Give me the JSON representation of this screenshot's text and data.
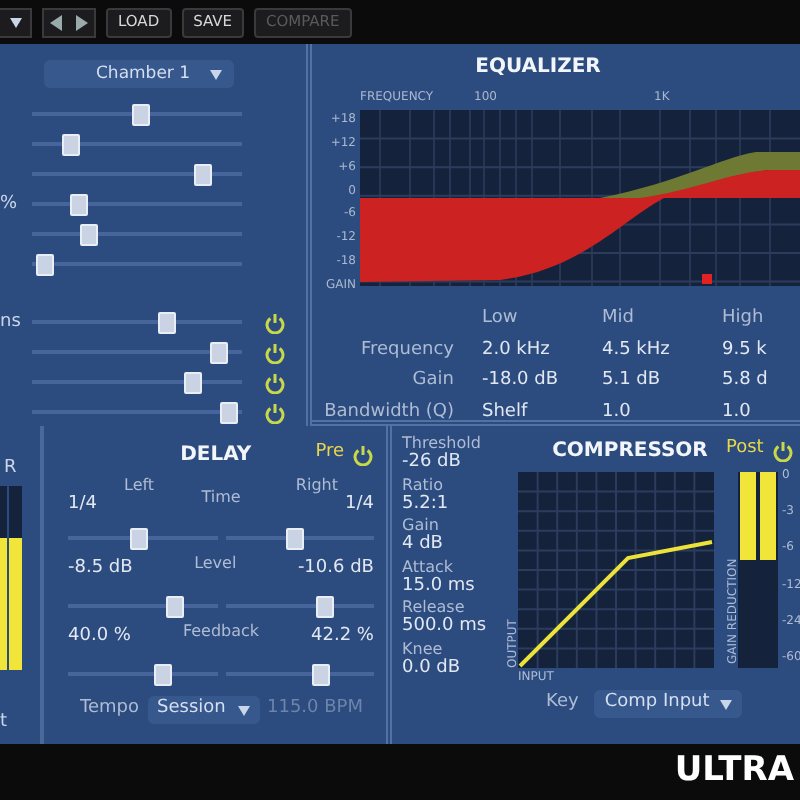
{
  "toolbar": {
    "buttons": [
      {
        "label": "LOAD",
        "disabled": false
      },
      {
        "label": "SAVE",
        "disabled": false
      },
      {
        "label": "COMPARE",
        "disabled": true
      }
    ]
  },
  "reverb": {
    "preset": "Chamber 1",
    "sliders": [
      {
        "level": 0.52
      },
      {
        "level": 0.16
      },
      {
        "level": 0.84
      },
      {
        "label": "%",
        "level": 0.2
      },
      {
        "level": 0.25
      },
      {
        "level": 0.02
      }
    ],
    "switched": [
      {
        "label": "ns",
        "level": 0.66,
        "on": true
      },
      {
        "level": 0.93,
        "on": true
      },
      {
        "level": 0.79,
        "on": true
      },
      {
        "level": 0.98,
        "on": true
      }
    ]
  },
  "equalizer": {
    "title": "EQUALIZER",
    "frequency_label": "FREQUENCY",
    "frequency_ticks": [
      "100",
      "1K"
    ],
    "gain_ticks": [
      "+18",
      "+12",
      "+6",
      "0",
      "-6",
      "-12",
      "-18"
    ],
    "gain_label": "GAIN",
    "bands": [
      "Low",
      "Mid",
      "High"
    ],
    "rows": [
      {
        "label": "Frequency",
        "values": [
          "2.0 kHz",
          "4.5 kHz",
          "9.5 k"
        ]
      },
      {
        "label": "Gain",
        "values": [
          "-18.0 dB",
          "5.1 dB",
          "5.8 d"
        ]
      },
      {
        "label": "Bandwidth (Q)",
        "values": [
          "Shelf",
          "1.0",
          "1.0"
        ]
      }
    ]
  },
  "meter": {
    "label": "R",
    "level": 0.72,
    "footer": "t"
  },
  "delay": {
    "title": "DELAY",
    "position": "Pre",
    "on": true,
    "channels": [
      "Left",
      "Right"
    ],
    "params": [
      {
        "label": "Time",
        "left": {
          "value": "1/4",
          "level": 0.48
        },
        "right": {
          "value": "1/4",
          "level": 0.47
        }
      },
      {
        "label": "Level",
        "left": {
          "value": "-8.5 dB",
          "level": 0.75
        },
        "right": {
          "value": "-10.6 dB",
          "level": 0.7
        }
      },
      {
        "label": "Feedback",
        "left": {
          "value": "40.0 %",
          "level": 0.66
        },
        "right": {
          "value": "42.2 %",
          "level": 0.66
        }
      }
    ],
    "tempo_label": "Tempo",
    "tempo": "Session",
    "bpm": "115.0 BPM"
  },
  "compressor": {
    "title": "COMPRESSOR",
    "position": "Post",
    "on": true,
    "params": [
      {
        "label": "Threshold",
        "value": "-26 dB"
      },
      {
        "label": "Ratio",
        "value": "5.2:1"
      },
      {
        "label": "Gain",
        "value": "4 dB"
      },
      {
        "label": "Attack",
        "value": "15.0 ms"
      },
      {
        "label": "Release",
        "value": "500.0 ms"
      },
      {
        "label": "Knee",
        "value": "0.0 dB"
      }
    ],
    "output_label": "OUTPUT",
    "input_label": "INPUT",
    "reduction_meter": {
      "label": "GAIN REDUCTION",
      "level": 0.45
    },
    "scale": [
      "0",
      "-3",
      "-6",
      "-12",
      "-24",
      "-60"
    ],
    "key_label": "Key",
    "key": "Comp Input"
  },
  "brand": "ULTRA"
}
